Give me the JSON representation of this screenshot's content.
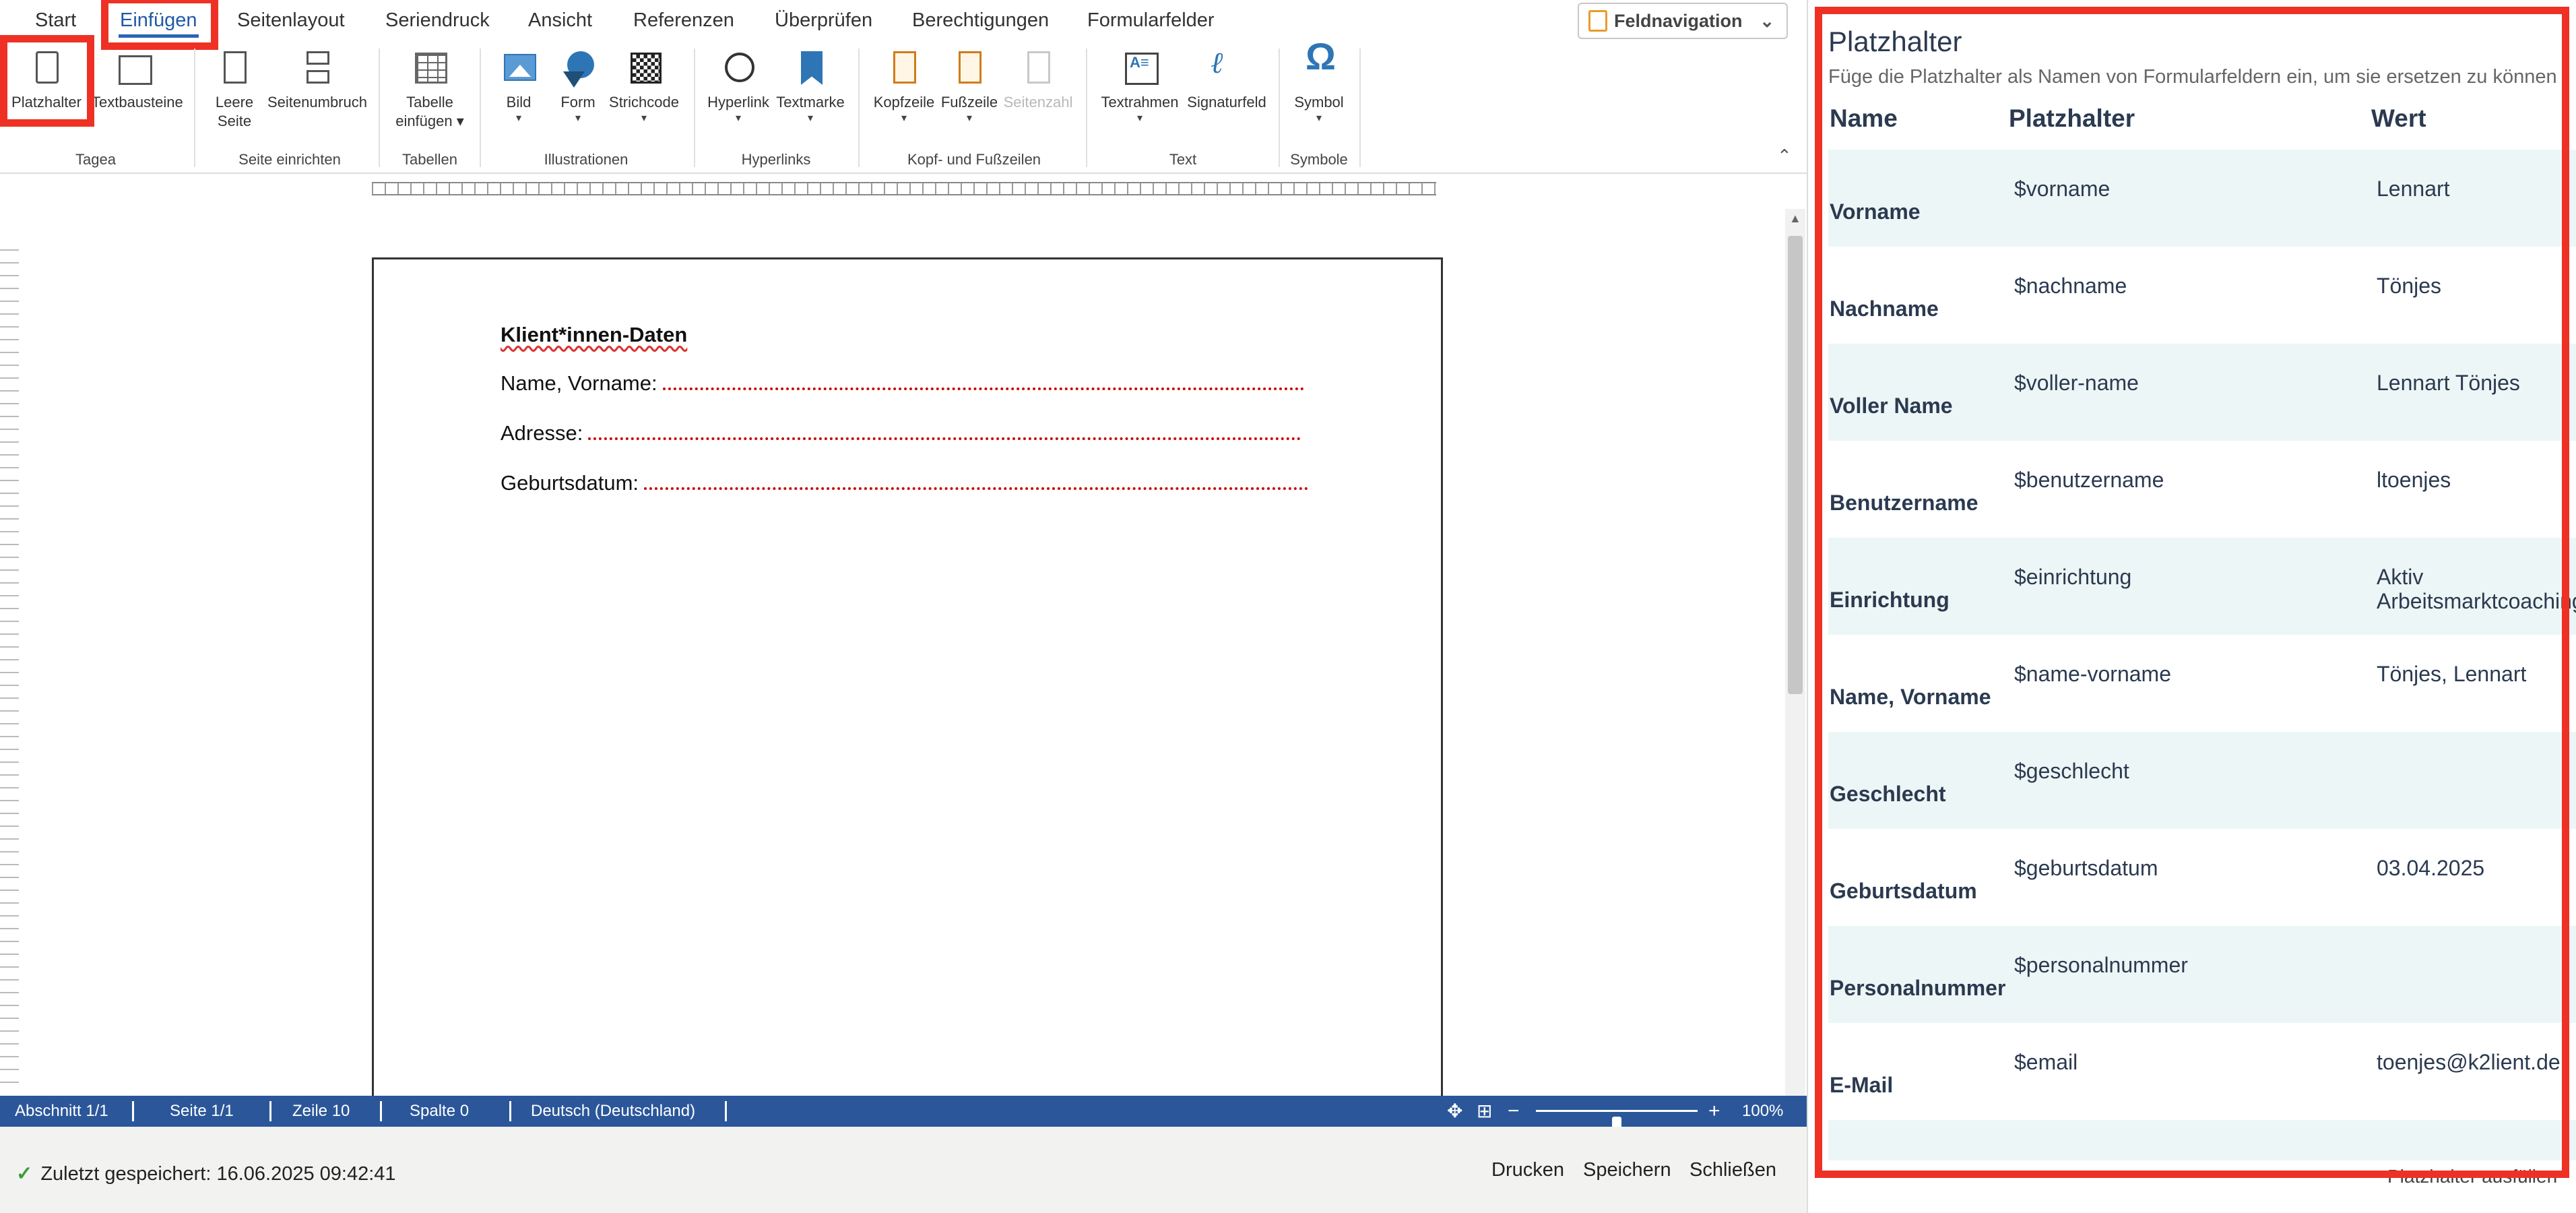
{
  "menu": {
    "tabs": [
      "Start",
      "Einfügen",
      "Seitenlayout",
      "Seriendruck",
      "Ansicht",
      "Referenzen",
      "Überprüfen",
      "Berechtigungen",
      "Formularfelder"
    ],
    "active_tab": "Einfügen",
    "feldnavigation": "Feldnavigation"
  },
  "ribbon": {
    "platzhalter": "Platzhalter",
    "textbausteine": "Textbausteine",
    "group_tagea": "Tagea",
    "leere_seite_1": "Leere",
    "leere_seite_2": "Seite",
    "seitenumbruch": "Seitenumbruch",
    "group_seite": "Seite einrichten",
    "tabelle_1": "Tabelle",
    "tabelle_2": "einfügen ▾",
    "group_tabellen": "Tabellen",
    "bild": "Bild",
    "form": "Form",
    "strichcode": "Strichcode",
    "group_illustrationen": "Illustrationen",
    "hyperlink": "Hyperlink",
    "textmarke": "Textmarke",
    "group_hyperlinks": "Hyperlinks",
    "kopfzeile": "Kopfzeile",
    "fusszeile": "Fußzeile",
    "seitenzahl": "Seitenzahl",
    "group_kopf": "Kopf- und Fußzeilen",
    "textrahmen": "Textrahmen",
    "signaturfeld": "Signaturfeld",
    "group_text": "Text",
    "symbol": "Symbol",
    "group_symbole": "Symbole",
    "dropdown": "▾"
  },
  "document": {
    "title": "Klient*innen-Daten",
    "field_name": "Name, Vorname:",
    "field_adresse": "Adresse:",
    "field_geburtsdatum": "Geburtsdatum:"
  },
  "status": {
    "abschnitt": "Abschnitt 1/1",
    "seite": "Seite 1/1",
    "zeile": "Zeile 10",
    "spalte": "Spalte 0",
    "sprache": "Deutsch (Deutschland)",
    "zoom": "100%",
    "zoom_level": 0.5
  },
  "footer": {
    "saved": "Zuletzt gespeichert: 16.06.2025 09:42:41",
    "drucken": "Drucken",
    "speichern": "Speichern",
    "schliessen": "Schließen"
  },
  "panel": {
    "title": "Platzhalter",
    "subtitle": "Füge die Platzhalter als Namen von Formularfeldern ein, um sie ersetzen zu können",
    "col_name": "Name",
    "col_platzhalter": "Platzhalter",
    "col_wert": "Wert",
    "rows": [
      {
        "name": "Vorname",
        "platzhalter": "$vorname",
        "wert": "Lennart"
      },
      {
        "name": "Nachname",
        "platzhalter": "$nachname",
        "wert": "Tönjes"
      },
      {
        "name": "Voller Name",
        "platzhalter": "$voller-name",
        "wert": "Lennart Tönjes"
      },
      {
        "name": "Benutzername",
        "platzhalter": "$benutzername",
        "wert": "ltoenjes"
      },
      {
        "name": "Einrichtung",
        "platzhalter": "$einrichtung",
        "wert": "Aktiv",
        "wert2": "Arbeitsmarktcoaching"
      },
      {
        "name": "Name, Vorname",
        "platzhalter": "$name-vorname",
        "wert": "Tönjes, Lennart"
      },
      {
        "name": "Geschlecht",
        "platzhalter": "$geschlecht",
        "wert": ""
      },
      {
        "name": "Geburtsdatum",
        "platzhalter": "$geburtsdatum",
        "wert": "03.04.2025"
      },
      {
        "name": "Personalnummer",
        "platzhalter": "$personalnummer",
        "wert": ""
      },
      {
        "name": "E-Mail",
        "platzhalter": "$email",
        "wert": "toenjes@k2lient.de"
      }
    ],
    "footer_link": "Platzhalter ausfüllen"
  },
  "colors": {
    "accent": "#2b579a",
    "highlight": "#ee3124",
    "row_alt": "#edf6f6"
  }
}
